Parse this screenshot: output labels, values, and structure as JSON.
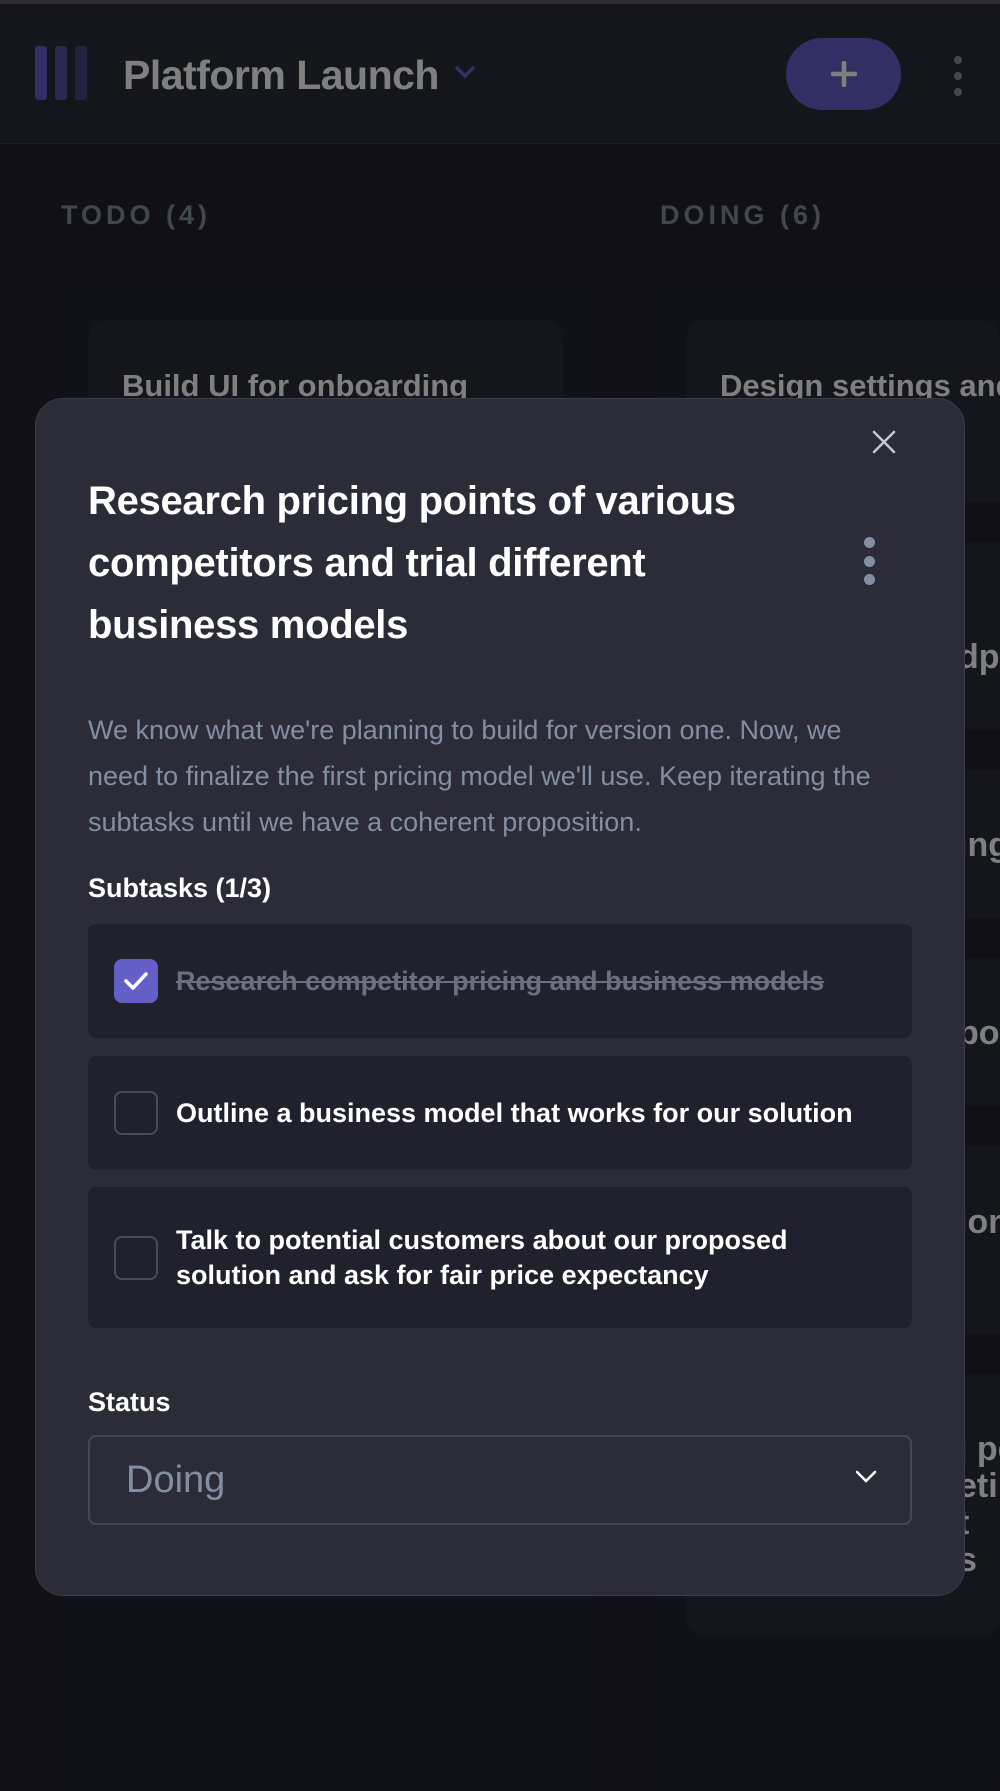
{
  "header": {
    "board_title": "Platform Launch",
    "add_button_symbol": "+"
  },
  "columns": [
    {
      "title": "TODO (4)"
    },
    {
      "title": "DOING (6)"
    }
  ],
  "background_cards": {
    "todo_first": "Build UI for onboarding",
    "doing_first": "Design settings and",
    "doing_peeks": [
      "dp",
      "ing",
      "poi",
      "ion",
      "j pe",
      "eti",
      "t",
      "s"
    ]
  },
  "modal": {
    "title": "Research pricing points of various competitors and trial different business models",
    "description": "We know what we're planning to build for version one. Now, we need to finalize the first pricing model we'll use. Keep iterating the subtasks until we have a coherent proposition.",
    "subtasks_label": "Subtasks (1/3)",
    "subtasks": [
      {
        "title": "Research competitor pricing and business models",
        "completed": true
      },
      {
        "title": "Outline a business model that works for our solution",
        "completed": false
      },
      {
        "title": "Talk to potential customers about our proposed solution and ask for fair price expectancy",
        "completed": false
      }
    ],
    "status_label": "Status",
    "status_value": "Doing"
  },
  "colors": {
    "accent": "#635FC7",
    "bg": "#20212C",
    "surface": "#2B2C37",
    "muted_text": "#828FA3"
  },
  "icons": [
    "logo-icon",
    "chevron-down-icon",
    "plus-icon",
    "kebab-menu-icon",
    "close-icon",
    "check-icon"
  ]
}
